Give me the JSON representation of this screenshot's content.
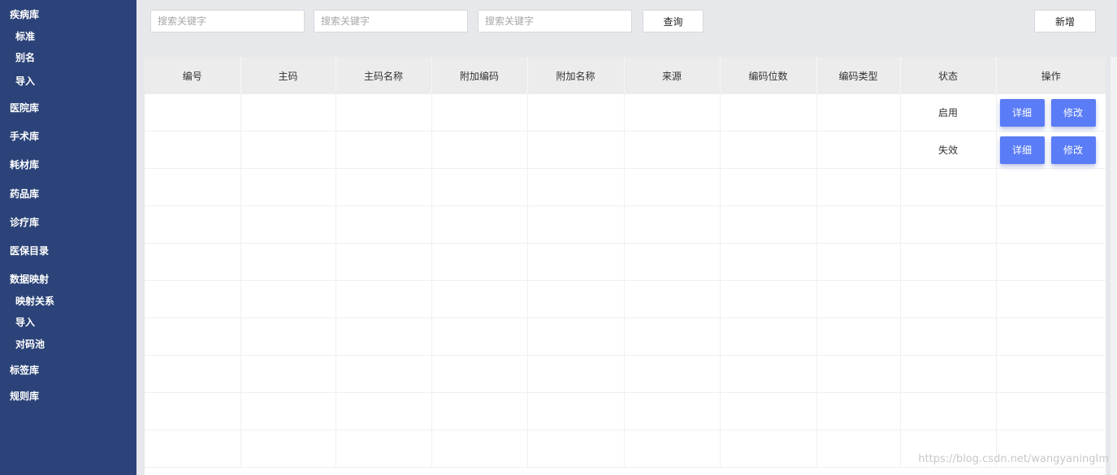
{
  "sidebar": {
    "items": [
      {
        "label": "疾病库",
        "sub": false
      },
      {
        "label": "标准",
        "sub": true
      },
      {
        "label": "别名",
        "sub": true
      },
      {
        "label": "导入",
        "sub": true
      },
      {
        "label": "医院库",
        "sub": false
      },
      {
        "label": "手术库",
        "sub": false
      },
      {
        "label": "耗材库",
        "sub": false
      },
      {
        "label": "药品库",
        "sub": false
      },
      {
        "label": "诊疗库",
        "sub": false
      },
      {
        "label": "医保目录",
        "sub": false
      },
      {
        "label": "数据映射",
        "sub": false
      },
      {
        "label": "映射关系",
        "sub": true
      },
      {
        "label": "导入",
        "sub": true
      },
      {
        "label": "对码池",
        "sub": true
      },
      {
        "label": "标签库",
        "sub": false
      },
      {
        "label": "规则库",
        "sub": false
      }
    ]
  },
  "toolbar": {
    "search1_placeholder": "搜索关键字",
    "search2_placeholder": "搜索关键字",
    "search3_placeholder": "搜索关键字",
    "query_label": "查询",
    "add_label": "新增"
  },
  "table": {
    "columns": [
      "编号",
      "主码",
      "主码名称",
      "附加编码",
      "附加名称",
      "来源",
      "编码位数",
      "编码类型",
      "状态",
      "操作"
    ],
    "rows": [
      {
        "status": "启用",
        "detail": "详细",
        "edit": "修改"
      },
      {
        "status": "失效",
        "detail": "详细",
        "edit": "修改"
      }
    ],
    "empty_rows": 8
  },
  "watermark": "https://blog.csdn.net/wangyaningIm"
}
